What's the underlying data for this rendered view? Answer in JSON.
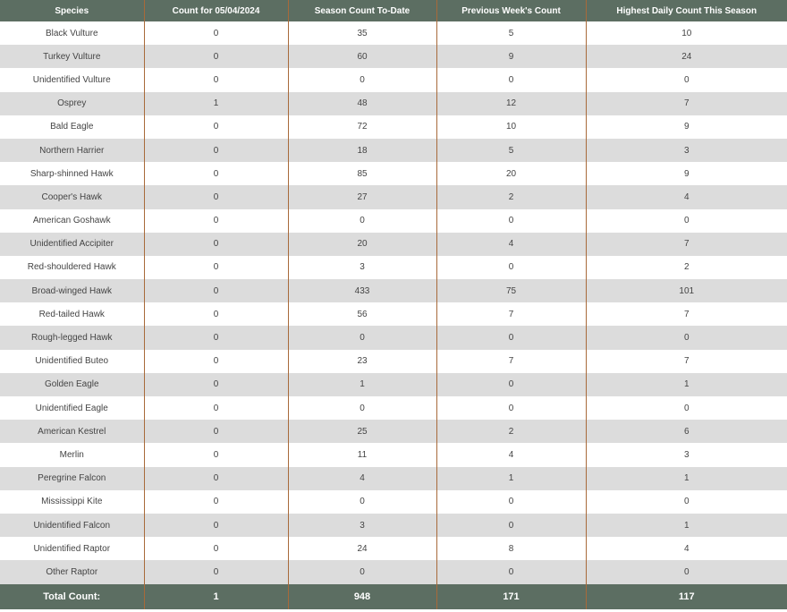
{
  "colors": {
    "header_bg": "#5c6e62",
    "header_text": "#ffffff",
    "row_alt_bg": "#dcdcdc",
    "row_bg": "#ffffff",
    "divider": "#a86a3a",
    "cell_text": "#444444"
  },
  "table": {
    "headers": [
      "Species",
      "Count for 05/04/2024",
      "Season Count To-Date",
      "Previous Week's Count",
      "Highest Daily Count This Season"
    ],
    "rows": [
      [
        "Black Vulture",
        "0",
        "35",
        "5",
        "10"
      ],
      [
        "Turkey Vulture",
        "0",
        "60",
        "9",
        "24"
      ],
      [
        "Unidentified Vulture",
        "0",
        "0",
        "0",
        "0"
      ],
      [
        "Osprey",
        "1",
        "48",
        "12",
        "7"
      ],
      [
        "Bald Eagle",
        "0",
        "72",
        "10",
        "9"
      ],
      [
        "Northern Harrier",
        "0",
        "18",
        "5",
        "3"
      ],
      [
        "Sharp-shinned Hawk",
        "0",
        "85",
        "20",
        "9"
      ],
      [
        "Cooper's Hawk",
        "0",
        "27",
        "2",
        "4"
      ],
      [
        "American Goshawk",
        "0",
        "0",
        "0",
        "0"
      ],
      [
        "Unidentified Accipiter",
        "0",
        "20",
        "4",
        "7"
      ],
      [
        "Red-shouldered Hawk",
        "0",
        "3",
        "0",
        "2"
      ],
      [
        "Broad-winged Hawk",
        "0",
        "433",
        "75",
        "101"
      ],
      [
        "Red-tailed Hawk",
        "0",
        "56",
        "7",
        "7"
      ],
      [
        "Rough-legged Hawk",
        "0",
        "0",
        "0",
        "0"
      ],
      [
        "Unidentified Buteo",
        "0",
        "23",
        "7",
        "7"
      ],
      [
        "Golden Eagle",
        "0",
        "1",
        "0",
        "1"
      ],
      [
        "Unidentified Eagle",
        "0",
        "0",
        "0",
        "0"
      ],
      [
        "American Kestrel",
        "0",
        "25",
        "2",
        "6"
      ],
      [
        "Merlin",
        "0",
        "11",
        "4",
        "3"
      ],
      [
        "Peregrine Falcon",
        "0",
        "4",
        "1",
        "1"
      ],
      [
        "Mississippi Kite",
        "0",
        "0",
        "0",
        "0"
      ],
      [
        "Unidentified Falcon",
        "0",
        "3",
        "0",
        "1"
      ],
      [
        "Unidentified Raptor",
        "0",
        "24",
        "8",
        "4"
      ],
      [
        "Other Raptor",
        "0",
        "0",
        "0",
        "0"
      ]
    ],
    "total": [
      "Total Count:",
      "1",
      "948",
      "171",
      "117"
    ]
  }
}
